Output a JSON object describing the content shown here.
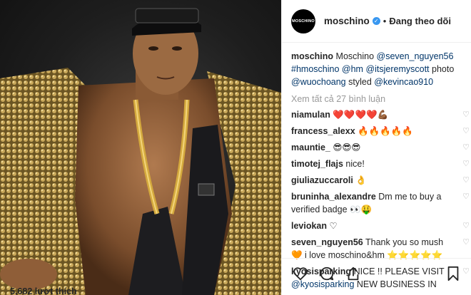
{
  "header": {
    "avatar_text": "MOSCHINO",
    "username": "moschino",
    "verified_icon": "verified-badge-icon",
    "separator": "•",
    "follow_label": "Đang theo dõi"
  },
  "caption": {
    "username": "moschino",
    "parts": [
      {
        "text": "Moschino ",
        "type": "text"
      },
      {
        "text": "@seven_nguyen56",
        "type": "mention"
      },
      {
        "text": " ",
        "type": "text"
      },
      {
        "text": "#hmoschino",
        "type": "mention"
      },
      {
        "text": " ",
        "type": "text"
      },
      {
        "text": "@hm",
        "type": "mention"
      },
      {
        "text": " ",
        "type": "text"
      },
      {
        "text": "@itsjeremyscott",
        "type": "mention"
      },
      {
        "text": " photo ",
        "type": "text"
      },
      {
        "text": "@wuochoang",
        "type": "mention"
      },
      {
        "text": " styled ",
        "type": "text"
      },
      {
        "text": "@kevincao910",
        "type": "mention"
      }
    ]
  },
  "view_all_label": "Xem tất cả 27 bình luận",
  "comments": [
    {
      "user": "niamulan",
      "text": "❤️❤️❤️❤️💪🏾"
    },
    {
      "user": "francess_alexx",
      "text": "🔥🔥🔥🔥🔥"
    },
    {
      "user": "mauntie_",
      "text": "😎😎😎"
    },
    {
      "user": "timotej_flajs",
      "text": "nice!"
    },
    {
      "user": "giuliazuccaroli",
      "text": "👌"
    },
    {
      "user": "bruninha_alexandre",
      "text": "Dm me to buy a verified badge 👀🤑"
    },
    {
      "user": "leviokan",
      "text": "♡"
    },
    {
      "user": "seven_nguyen56",
      "text": "Thank you so mush 🧡 i love moschino&hm ⭐⭐⭐⭐⭐"
    },
    {
      "user": "kyosisparking",
      "text": "NICE !! PLEASE VISIT @kyosisparking NEW BUSINESS IN"
    }
  ],
  "actions": {
    "like_icon": "heart-outline-icon",
    "comment_icon": "comment-icon",
    "share_icon": "share-icon",
    "save_icon": "bookmark-icon"
  },
  "likes_label": "5,682 lượt thích",
  "colors": {
    "mention": "#003569",
    "verified": "#3897f0",
    "muted": "#999999",
    "text": "#262626"
  }
}
